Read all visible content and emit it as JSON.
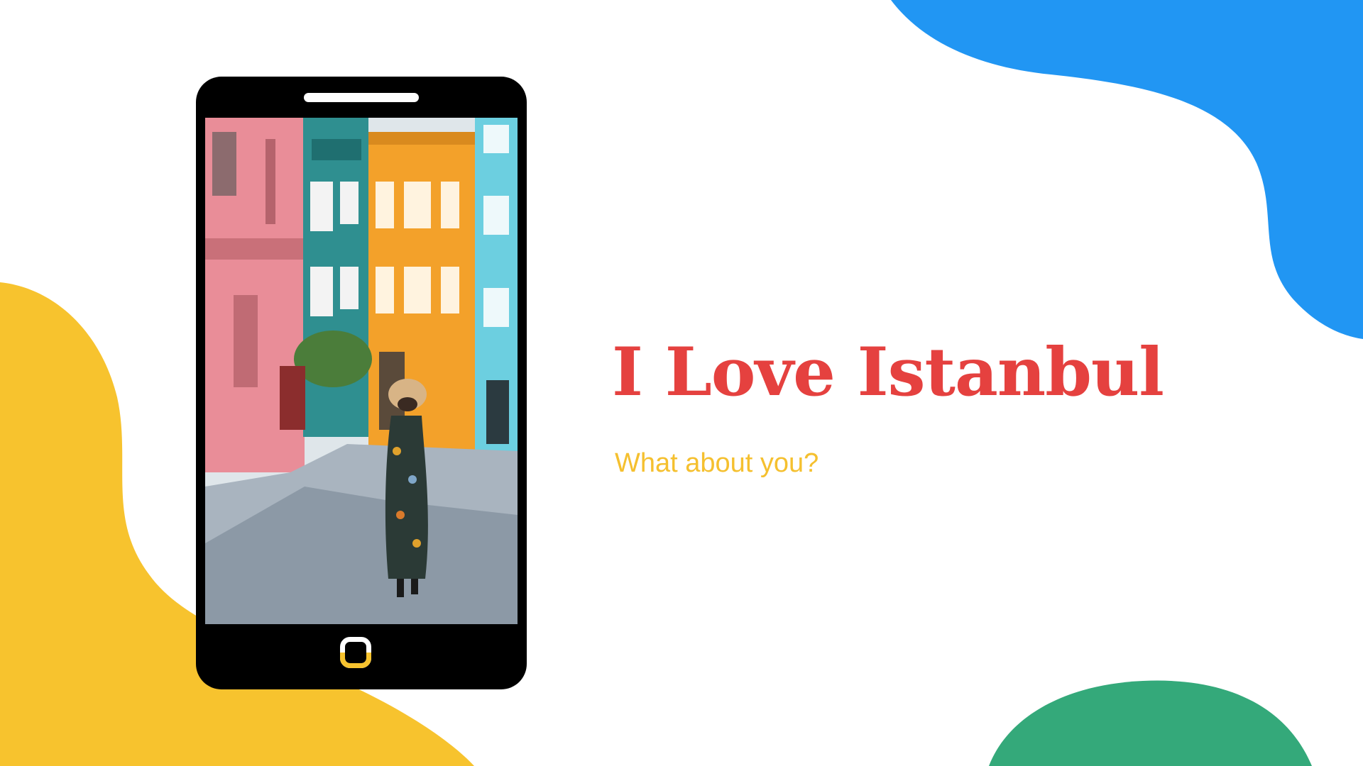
{
  "slide": {
    "title": "I Love Istanbul",
    "subtitle": "What about you?"
  },
  "phone": {
    "screen_image": "photo of a woman in a sun hat and floral dress walking on a cobblestone street lined with colorful pink, teal, orange and blue houses"
  },
  "colors": {
    "title": "#e5413f",
    "subtitle": "#f5c02f",
    "blob_yellow": "#f7c32e",
    "blob_blue": "#2196f3",
    "blob_green": "#34a97a",
    "phone_body": "#000000"
  }
}
